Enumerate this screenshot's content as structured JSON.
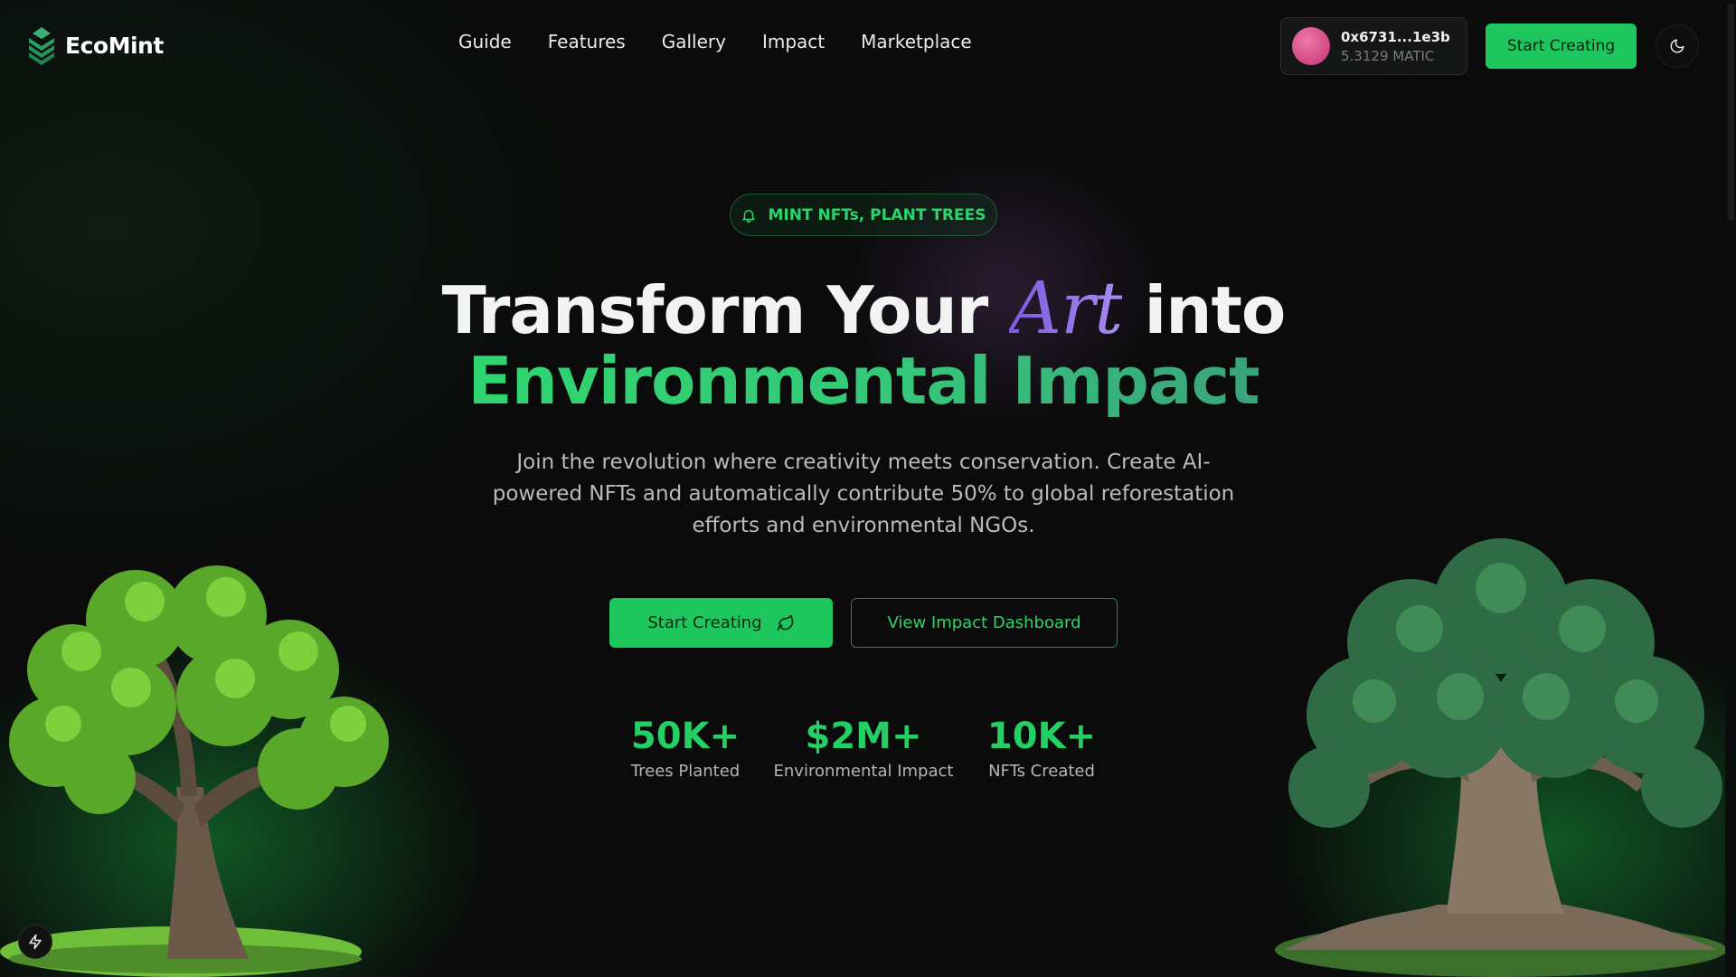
{
  "brand": {
    "name": "EcoMint",
    "logo_icon": "leaf-stack-icon",
    "accent": "#1ec75d"
  },
  "nav": {
    "items": [
      {
        "label": "Guide"
      },
      {
        "label": "Features"
      },
      {
        "label": "Gallery"
      },
      {
        "label": "Impact"
      },
      {
        "label": "Marketplace"
      }
    ]
  },
  "wallet": {
    "address": "0x6731...1e3b",
    "balance": "5.3129 MATIC"
  },
  "header": {
    "cta_label": "Start Creating",
    "theme_icon": "moon-icon"
  },
  "hero": {
    "badge": {
      "icon": "bell-icon",
      "label": "MINT NFTs, PLANT TREES"
    },
    "headline": {
      "line1_before": "Transform Your ",
      "accent_word": "Art",
      "line1_after": " into",
      "line2": "Environmental Impact"
    },
    "subtitle": "Join the revolution where creativity meets conservation. Create AI-powered NFTs and automatically contribute 50% to global reforestation efforts and environmental NGOs.",
    "primary_button": {
      "label": "Start Creating",
      "icon": "leaf-icon"
    },
    "secondary_button": {
      "label": "View Impact Dashboard"
    }
  },
  "stats": [
    {
      "value": "50K+",
      "label": "Trees Planted"
    },
    {
      "value": "$2M+",
      "label": "Environmental Impact"
    },
    {
      "value": "10K+",
      "label": "NFTs Created"
    }
  ],
  "fab": {
    "icon": "lightning-icon"
  }
}
